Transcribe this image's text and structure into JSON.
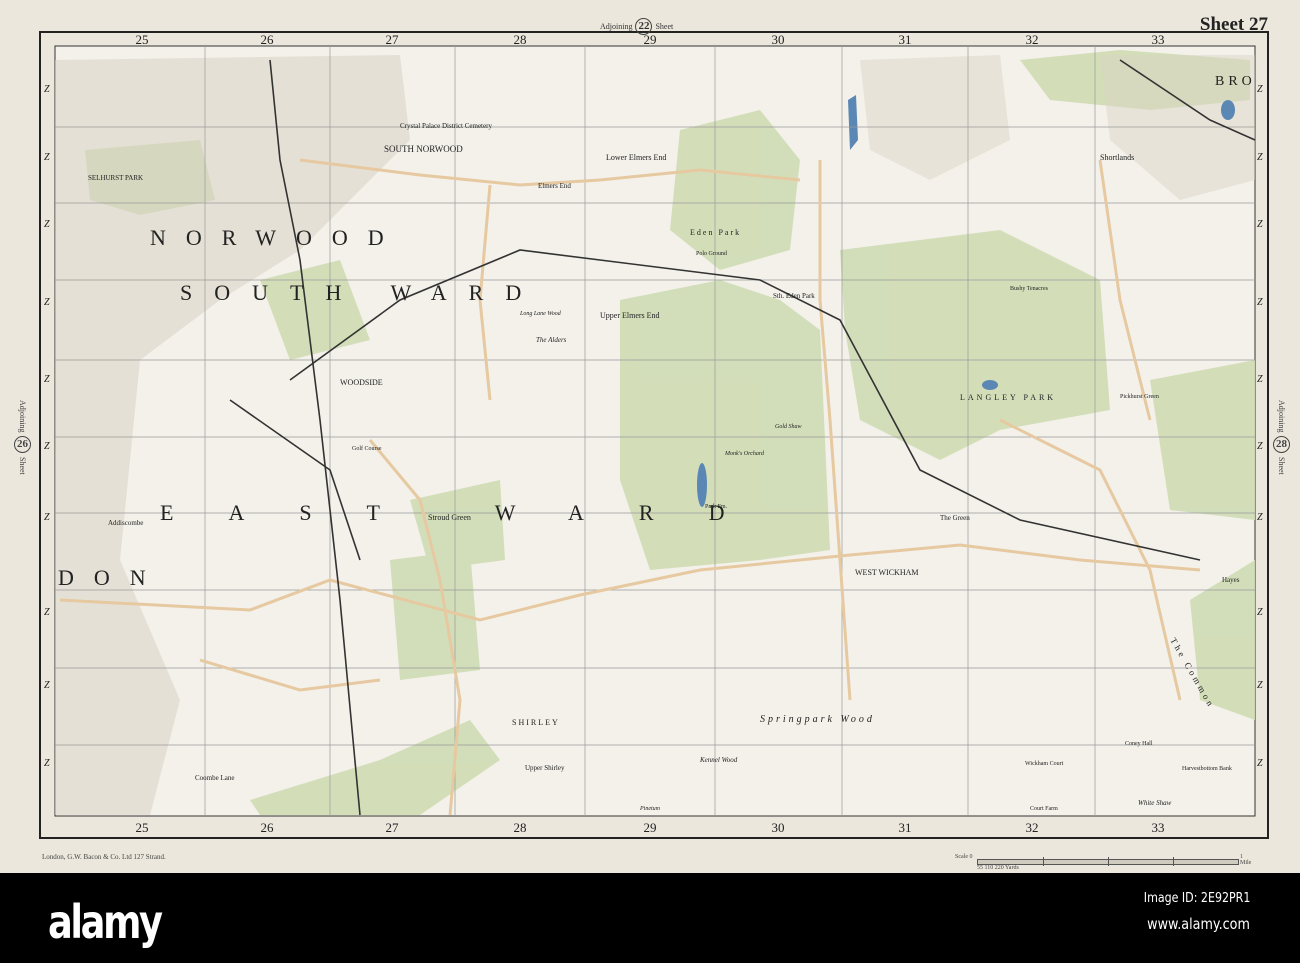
{
  "sheet": {
    "title": "Sheet 27",
    "adjoining_top": {
      "label_left": "Adjoining",
      "number": "22",
      "label_right": "Sheet"
    },
    "adjoining_left": {
      "label_left": "Adjoining",
      "number": "26",
      "label_right": "Sheet"
    },
    "adjoining_right": {
      "label_left": "Adjoining",
      "number": "28",
      "label_right": "Sheet"
    },
    "publisher": "London, G.W. Bacon & Co. Ltd 127 Strand.",
    "scale": {
      "label": "Scale 0",
      "end_label": "1 Mile",
      "yards_label": "55 110  220 Yards"
    }
  },
  "grid": {
    "columns": [
      "25",
      "26",
      "27",
      "28",
      "29",
      "30",
      "31",
      "32",
      "33"
    ],
    "row_label": "Z"
  },
  "places": {
    "south_norwood": "SOUTH NORWOOD",
    "norwood": "NORWOOD",
    "south_ward": "SOUTH WARD",
    "woodside": "WOODSIDE",
    "east_ward": "EAST WARD",
    "croydon": "DON",
    "selhurst_park": "SELHURST PARK",
    "crystal_palace_cemetery": "Crystal Palace District Cemetery",
    "elmers_end": "Elmers End",
    "lower_elmers_end": "Lower Elmers End",
    "upper_elmers_end": "Upper Elmers End",
    "eden_park": "Eden Park",
    "polo_ground": "Polo Ground",
    "sth_eden_park": "Sth. Eden Park",
    "langley_park": "LANGLEY PARK",
    "shortlands": "Shortlands",
    "bromley": "BRO",
    "stroud_green": "Stroud Green",
    "west_wickham": "WEST WICKHAM",
    "shirley": "SHIRLEY",
    "upper_shirley": "Upper Shirley",
    "springpark_wood": "Springpark Wood",
    "kennel_wood": "Kennel Wood",
    "the_common": "The Common",
    "coombe_lane": "Coombe Lane",
    "addiscombe": "Addiscombe",
    "the_alders": "The Alders",
    "long_lane_wood": "Long Lane Wood",
    "pickhurst_green": "Pickhurst Green",
    "hayes": "Hayes",
    "the_green": "The Green",
    "golf_course": "Golf Course",
    "pinetum": "Pinetum",
    "white_shaw": "White Shaw",
    "harvestbottom_bank": "Harvestbottom Bank",
    "wickham_court": "Wickham Court",
    "court_farm": "Court Farm",
    "coney_hall": "Coney Hall",
    "bushy_tenacres": "Bushy Tenacres",
    "park_farm": "Park Fm.",
    "monks_orchard": "Monk's Orchard",
    "gold_shaw": "Gold Shaw"
  },
  "colors": {
    "paper": "#ebe7dc",
    "map": "#f3f1ea",
    "park": "#cfdcb4",
    "water": "#5b87b5",
    "road": "#e6c9a0",
    "rail": "#333333"
  },
  "watermark": {
    "logo": "alamy",
    "image_id": "Image ID: 2E92PR1",
    "url": "www.alamy.com"
  }
}
